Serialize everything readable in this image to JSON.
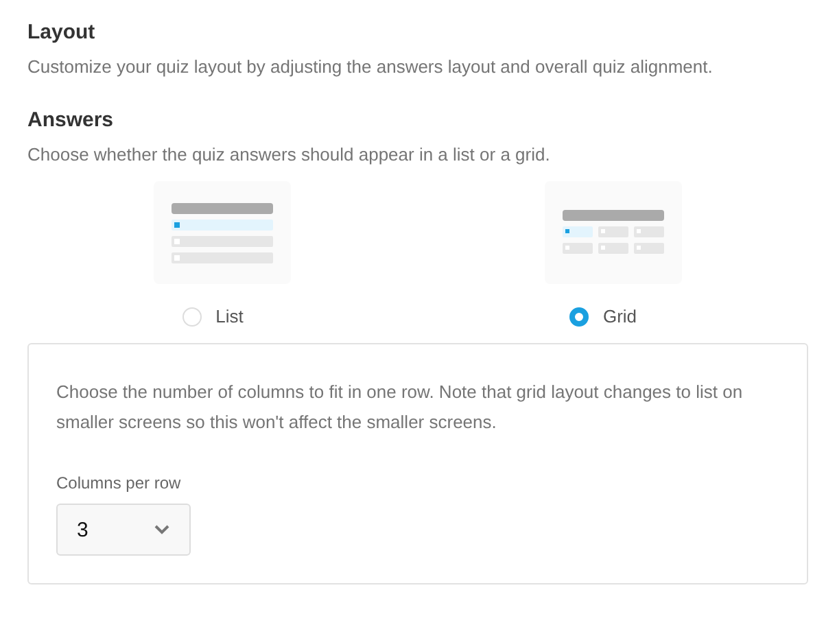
{
  "section": {
    "title": "Layout",
    "description": "Customize your quiz layout by adjusting the answers layout and overall quiz alignment."
  },
  "answers": {
    "title": "Answers",
    "description": "Choose whether the quiz answers should appear in a list or a grid.",
    "options": [
      {
        "kind": "list",
        "label": "List",
        "selected": false
      },
      {
        "kind": "grid",
        "label": "Grid",
        "selected": true
      }
    ]
  },
  "grid_settings": {
    "note": "Choose the number of columns to fit in one row. Note that grid layout changes to list on smaller screens so this won't affect the smaller screens.",
    "field_label": "Columns per row",
    "value": "3"
  }
}
